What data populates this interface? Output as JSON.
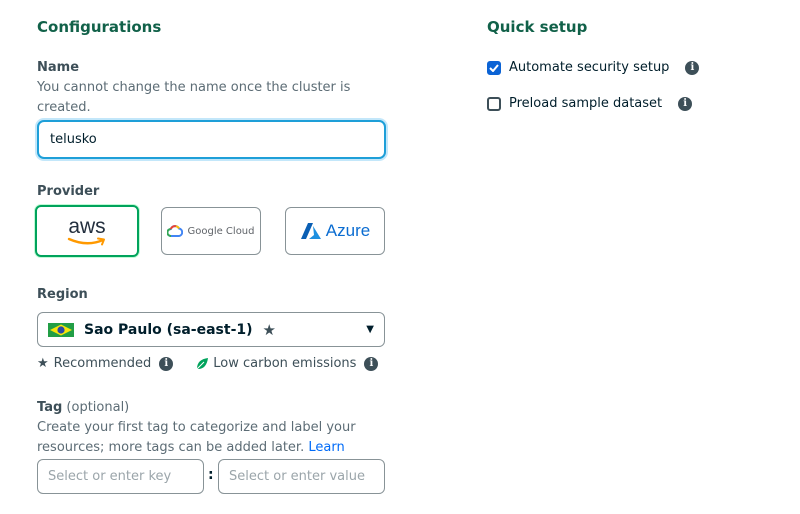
{
  "configurations": {
    "title": "Configurations",
    "name": {
      "label": "Name",
      "help": "You cannot change the name once the cluster is created.",
      "value": "telusko"
    },
    "provider": {
      "label": "Provider",
      "options": [
        {
          "key": "aws",
          "label": "aws",
          "icon": "aws-logo-icon",
          "selected": true
        },
        {
          "key": "gcp",
          "label": "Google Cloud",
          "icon": "google-cloud-logo-icon",
          "selected": false
        },
        {
          "key": "azure",
          "label": "Azure",
          "icon": "azure-logo-icon",
          "selected": false
        }
      ]
    },
    "region": {
      "label": "Region",
      "selected": "Sao Paulo (sa-east-1)",
      "flag_icon": "brazil-flag-icon",
      "recommended_label": "Recommended",
      "low_carbon_label": "Low carbon emissions"
    },
    "tag": {
      "label": "Tag",
      "optional": "(optional)",
      "help": "Create your first tag to categorize and label your resources; more tags can be added later.",
      "learn_more": "Learn more.",
      "key_placeholder": "Select or enter key",
      "separator": ":",
      "value_placeholder": "Select or enter value"
    }
  },
  "quick_setup": {
    "title": "Quick setup",
    "options": [
      {
        "label": "Automate security setup",
        "checked": true
      },
      {
        "label": "Preload sample dataset",
        "checked": false
      }
    ]
  },
  "colors": {
    "heading": "#116149",
    "selected_border": "#00a35c",
    "focus_border": "#1e9fd8",
    "checkbox_blue": "#0b63d5",
    "link": "#016bf8"
  }
}
